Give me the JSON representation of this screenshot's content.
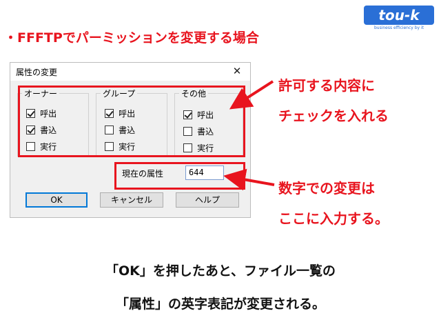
{
  "header": {
    "heading": "・FFFTPでパーミッションを変更する場合",
    "logo_text": "tou-k",
    "logo_tagline": "business efficiency by it"
  },
  "dialog": {
    "title": "属性の変更",
    "close_glyph": "✕",
    "groups": [
      {
        "label": "オーナー",
        "items": [
          {
            "label": "呼出",
            "checked": true
          },
          {
            "label": "書込",
            "checked": true
          },
          {
            "label": "実行",
            "checked": false
          }
        ]
      },
      {
        "label": "グループ",
        "items": [
          {
            "label": "呼出",
            "checked": true
          },
          {
            "label": "書込",
            "checked": false
          },
          {
            "label": "実行",
            "checked": false
          }
        ]
      },
      {
        "label": "その他",
        "items": [
          {
            "label": "呼出",
            "checked": true
          },
          {
            "label": "書込",
            "checked": false
          },
          {
            "label": "実行",
            "checked": false
          }
        ]
      }
    ],
    "current_label": "現在の属性",
    "current_value": "644",
    "buttons": {
      "ok": "OK",
      "cancel": "キャンセル",
      "help": "ヘルプ"
    }
  },
  "callouts": {
    "checkbox_line1": "許可する内容に",
    "checkbox_line2": "チェックを入れる",
    "number_line1": "数字での変更は",
    "number_line2": "ここに入力する。"
  },
  "caption": {
    "line1": "「OK」を押したあと、ファイル一覧の",
    "line2": "「属性」の英字表記が変更される。"
  },
  "colors": {
    "accent_red": "#e8141e",
    "logo_blue": "#2a6fd6"
  }
}
